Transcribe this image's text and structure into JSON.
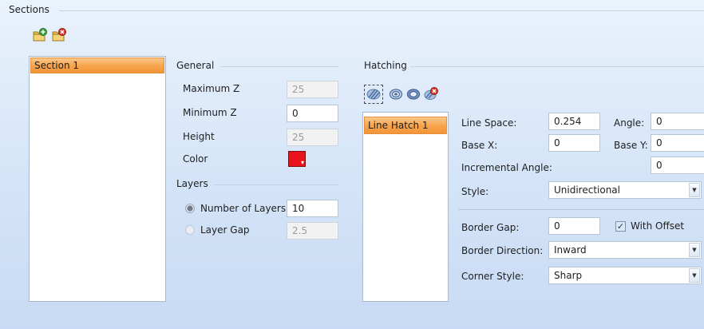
{
  "sections": {
    "title": "Sections",
    "toolbar": {
      "add_icon": "add-folder-icon",
      "remove_icon": "remove-folder-icon"
    },
    "list": [
      "Section 1"
    ]
  },
  "general": {
    "title": "General",
    "max_z": {
      "label": "Maximum Z",
      "value": "25"
    },
    "min_z": {
      "label": "Minimum Z",
      "value": "0"
    },
    "height": {
      "label": "Height",
      "value": "25"
    },
    "color": {
      "label": "Color",
      "value": "#e8141c"
    }
  },
  "layers": {
    "title": "Layers",
    "num_layers": {
      "label": "Number of Layers",
      "value": "10",
      "selected": true
    },
    "layer_gap": {
      "label": "Layer Gap",
      "value": "2.5",
      "selected": false
    }
  },
  "hatching": {
    "title": "Hatching",
    "tools": [
      "line-hatch-icon",
      "contour-hatch-icon",
      "offset-hatch-icon",
      "delete-hatch-icon"
    ],
    "list": [
      "Line Hatch 1"
    ],
    "line_space": {
      "label": "Line Space:",
      "value": "0.254"
    },
    "angle": {
      "label": "Angle:",
      "value": "0"
    },
    "base_x": {
      "label": "Base X:",
      "value": "0"
    },
    "base_y": {
      "label": "Base Y:",
      "value": "0"
    },
    "incremental_angle": {
      "label": "Incremental Angle:",
      "value": "0"
    },
    "style": {
      "label": "Style:",
      "value": "Unidirectional"
    },
    "border_gap": {
      "label": "Border Gap:",
      "value": "0"
    },
    "with_offset": {
      "label": "With Offset",
      "checked": true
    },
    "border_direction": {
      "label": "Border Direction:",
      "value": "Inward"
    },
    "corner_style": {
      "label": "Corner Style:",
      "value": "Sharp"
    }
  }
}
